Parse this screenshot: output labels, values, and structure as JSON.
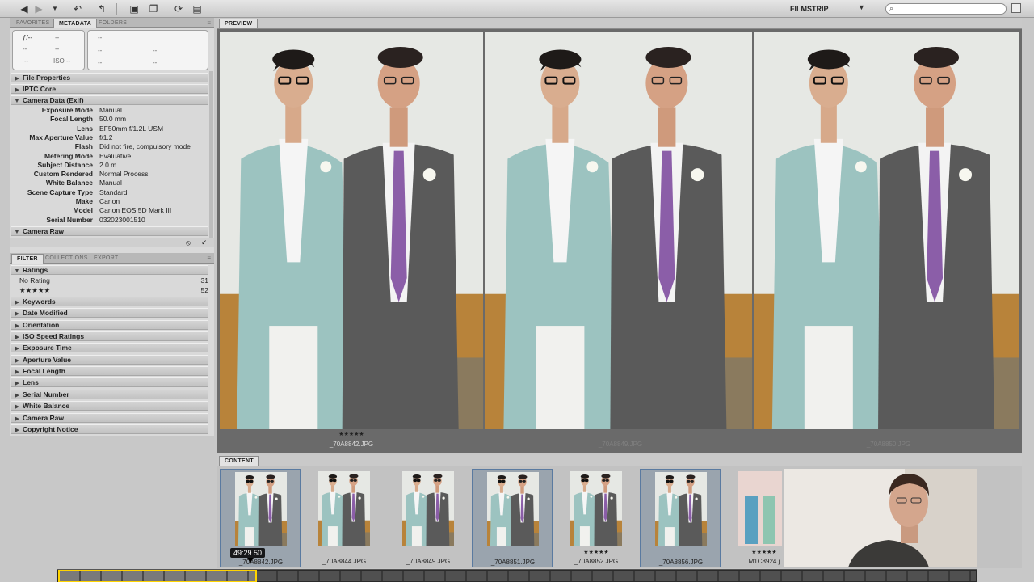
{
  "toolbar": {
    "workspace": "FILMSTRIP",
    "icons": [
      "back-arrow-icon",
      "forward-arrow-icon",
      "chevron-down-icon",
      "rotate-icon",
      "boomerang-icon",
      "camera-icon",
      "stack-icon",
      "refresh-icon",
      "open-with-icon"
    ]
  },
  "left_tabs": [
    "FAVORITES",
    "METADATA",
    "FOLDERS"
  ],
  "placard": {
    "aperture": "ƒ/--",
    "shutter": "--",
    "iso": "ISO --",
    "dash": "--"
  },
  "metadata_sections": {
    "file_properties": "File Properties",
    "iptc_core": "IPTC Core",
    "camera_data": "Camera Data (Exif)",
    "camera_raw": "Camera Raw"
  },
  "exif": [
    {
      "key": "Exposure Mode",
      "value": "Manual"
    },
    {
      "key": "Focal Length",
      "value": "50.0 mm"
    },
    {
      "key": "Lens",
      "value": "EF50mm f/1.2L USM"
    },
    {
      "key": "Max Aperture Value",
      "value": "f/1.2"
    },
    {
      "key": "Flash",
      "value": "Did not fire, compulsory mode"
    },
    {
      "key": "Metering Mode",
      "value": "Evaluative"
    },
    {
      "key": "Subject Distance",
      "value": "2.0 m"
    },
    {
      "key": "Custom Rendered",
      "value": "Normal Process"
    },
    {
      "key": "White Balance",
      "value": "Manual"
    },
    {
      "key": "Scene Capture Type",
      "value": "Standard"
    },
    {
      "key": "Make",
      "value": "Canon"
    },
    {
      "key": "Model",
      "value": "Canon EOS 5D Mark III"
    },
    {
      "key": "Serial Number",
      "value": "032023001510"
    }
  ],
  "filter_tabs": [
    "FILTER",
    "COLLECTIONS",
    "EXPORT"
  ],
  "filter": {
    "ratings_label": "Ratings",
    "rows": [
      {
        "label": "No Rating",
        "count": "31"
      },
      {
        "label": "★★★★★",
        "count": "52"
      }
    ],
    "categories": [
      "Keywords",
      "Date Modified",
      "Orientation",
      "ISO Speed Ratings",
      "Exposure Time",
      "Aperture Value",
      "Focal Length",
      "Lens",
      "Serial Number",
      "White Balance",
      "Camera Raw",
      "Copyright Notice"
    ]
  },
  "preview": {
    "tab": "PREVIEW",
    "photos": [
      {
        "stars": "★★★★★",
        "name": "_70A8842.JPG"
      },
      {
        "stars": "",
        "name": "_70A8849.JPG"
      },
      {
        "stars": "",
        "name": "_70A8850.JPG"
      }
    ]
  },
  "content": {
    "tab": "CONTENT",
    "thumbs": [
      {
        "name": "_70A8842.JPG",
        "stars": "",
        "selected": true
      },
      {
        "name": "_70A8844.JPG",
        "stars": "",
        "selected": false
      },
      {
        "name": "_70A8849.JPG",
        "stars": "",
        "selected": false
      },
      {
        "name": "_70A8851.JPG",
        "stars": "",
        "selected": true
      },
      {
        "name": "_70A8852.JPG",
        "stars": "★★★★★",
        "selected": false
      },
      {
        "name": "_70A8856.JPG",
        "stars": "",
        "selected": true
      },
      {
        "name": "M1C8924.j",
        "stars": "★★★★★",
        "selected": false
      }
    ]
  },
  "timecode": "49:29.50",
  "colors": {
    "suit_light": "#9cc3c0",
    "suit_dark": "#5a5a5a",
    "tie": "#8b5ea8",
    "wall": "#e6e8e4",
    "floor": "#b8833a",
    "selection": "#5a7aa0",
    "timeline_highlight": "#ffd400"
  }
}
